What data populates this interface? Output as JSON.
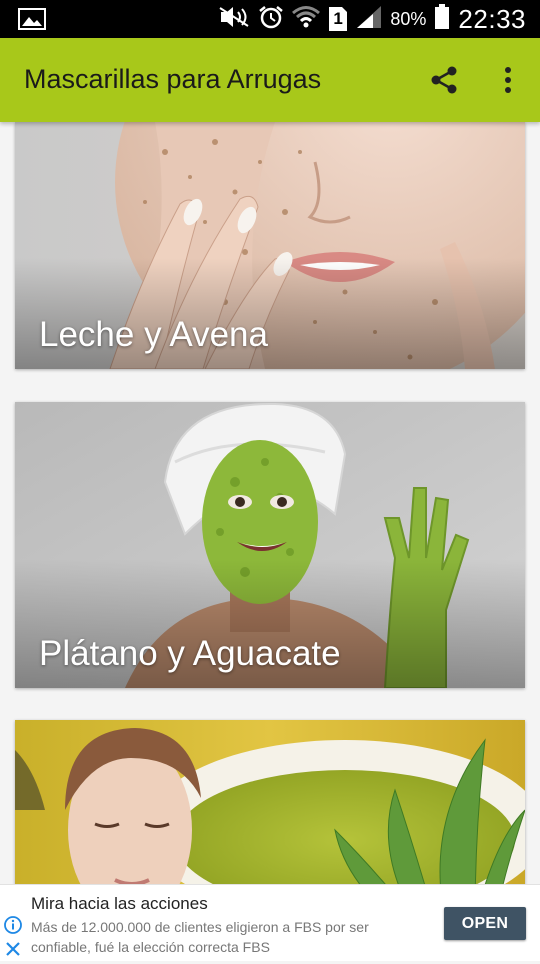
{
  "status_bar": {
    "battery_percent": "80%",
    "time": "22:33",
    "sim_slot": "1"
  },
  "app_bar": {
    "title": "Mascarillas para Arrugas"
  },
  "cards": [
    {
      "title": "Leche y Avena"
    },
    {
      "title": "Plátano y Aguacate"
    },
    {
      "title": ""
    }
  ],
  "ad": {
    "title": "Mira hacia las acciones",
    "text": "Más de 12.000.000 de clientes eligieron a FBS por ser confiable, fué la elección correcta FBS",
    "button_label": "OPEN"
  },
  "colors": {
    "app_bar": "#a8c81a",
    "ad_button": "#3f5364",
    "status_bar": "#000000"
  }
}
